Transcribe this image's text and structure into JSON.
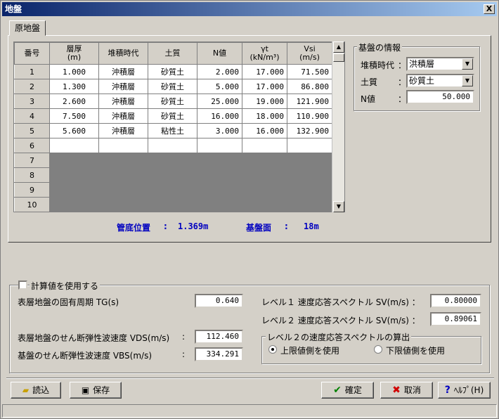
{
  "window": {
    "title": "地盤",
    "close": "X"
  },
  "tab": {
    "label": "原地盤"
  },
  "grid": {
    "headers": [
      "番号",
      "層厚\n(m)",
      "堆積時代",
      "土質",
      "N値",
      "γt\n(kN/m³)",
      "Vsi\n(m/s)"
    ],
    "rows": [
      [
        "1",
        "1.000",
        "沖積層",
        "砂質土",
        "2.000",
        "17.000",
        "71.500"
      ],
      [
        "2",
        "1.300",
        "沖積層",
        "砂質土",
        "5.000",
        "17.000",
        "86.800"
      ],
      [
        "3",
        "2.600",
        "沖積層",
        "砂質土",
        "25.000",
        "19.000",
        "121.900"
      ],
      [
        "4",
        "7.500",
        "沖積層",
        "砂質土",
        "16.000",
        "18.000",
        "110.900"
      ],
      [
        "5",
        "5.600",
        "沖積層",
        "粘性土",
        "3.000",
        "16.000",
        "132.900"
      ],
      [
        "6",
        "",
        "",
        "",
        "",
        "",
        ""
      ],
      [
        "7",
        "",
        "",
        "",
        "",
        "",
        ""
      ],
      [
        "8",
        "",
        "",
        "",
        "",
        "",
        ""
      ],
      [
        "9",
        "",
        "",
        "",
        "",
        "",
        ""
      ],
      [
        "10",
        "",
        "",
        "",
        "",
        "",
        ""
      ]
    ]
  },
  "base_info": {
    "title": "基盤の情報",
    "era_label": "堆積時代",
    "era_value": "洪積層",
    "soil_label": "土質",
    "soil_value": "砂質土",
    "n_label": "N値",
    "n_value": "50.000",
    "colon": "："
  },
  "summary": {
    "pipe_label": "管底位置",
    "pipe_value": "1.369m",
    "base_label": "基盤面",
    "base_value": "18m",
    "colon": ":"
  },
  "calc": {
    "checkbox_label": "計算値を使用する",
    "tg_label": "表層地盤の固有周期 TG(s)",
    "tg_value": "0.640",
    "vds_label": "表層地盤のせん断弾性波速度 VDS(m/s)",
    "vds_value": "112.460",
    "vbs_label": "基盤のせん断弾性波速度 VBS(m/s)",
    "vbs_value": "334.291",
    "colon": ":",
    "sv1_label": "レベル１ 速度応答スペクトル SV(m/s) ：",
    "sv1_value": "0.80000",
    "sv2_label": "レベル２ 速度応答スペクトル SV(m/s) ：",
    "sv2_value": "0.89061",
    "level2_group": "レベル２の速度応答スペクトルの算出",
    "radio_upper": "上限値側を使用",
    "radio_lower": "下限値側を使用"
  },
  "buttons": {
    "load": "読込",
    "save": "保存",
    "ok": "確定",
    "cancel": "取消",
    "help": "ﾍﾙﾌﾟ(H)"
  }
}
